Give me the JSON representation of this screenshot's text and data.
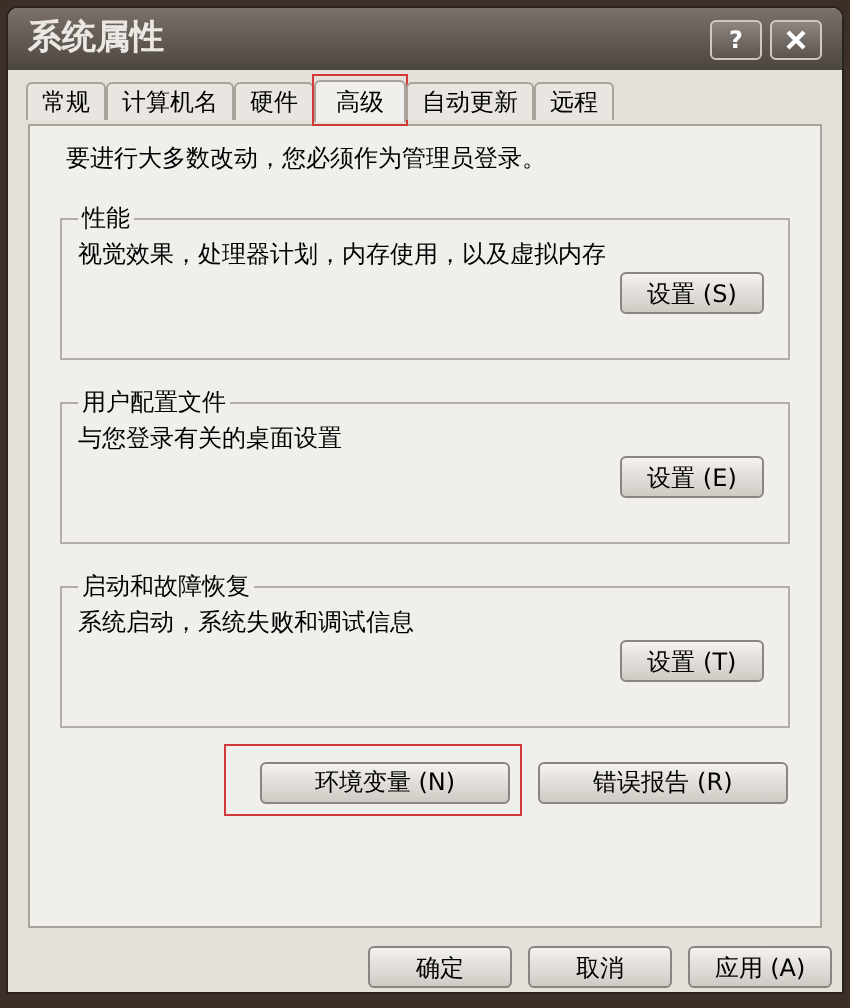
{
  "window": {
    "title": "系统属性",
    "controls": [
      {
        "kind": "help",
        "label": "?"
      },
      {
        "kind": "close"
      }
    ]
  },
  "tabs": [
    {
      "label": "常规",
      "selected": false,
      "highlighted": false
    },
    {
      "label": "计算机名",
      "selected": false,
      "highlighted": false
    },
    {
      "label": "硬件",
      "selected": false,
      "highlighted": false
    },
    {
      "label": "高级",
      "selected": true,
      "highlighted": true
    },
    {
      "label": "自动更新",
      "selected": false,
      "highlighted": false
    },
    {
      "label": "远程",
      "selected": false,
      "highlighted": false
    }
  ],
  "notice": "要进行大多数改动，您必须作为管理员登录。",
  "groups": [
    {
      "title": "性能",
      "description": "视觉效果，处理器计划，内存使用，以及虚拟内存",
      "button": {
        "label": "设置 (S)"
      }
    },
    {
      "title": "用户配置文件",
      "description": "与您登录有关的桌面设置",
      "button": {
        "label": "设置 (E)"
      }
    },
    {
      "title": "启动和故障恢复",
      "description": "系统启动，系统失败和调试信息",
      "button": {
        "label": "设置 (T)"
      }
    }
  ],
  "extra_buttons": [
    {
      "label": "环境变量 (N)",
      "highlighted": true
    },
    {
      "label": "错误报告 (R)",
      "highlighted": false
    }
  ],
  "dialog_buttons": [
    {
      "label": "确定"
    },
    {
      "label": "取消"
    },
    {
      "label": "应用 (A)"
    }
  ]
}
